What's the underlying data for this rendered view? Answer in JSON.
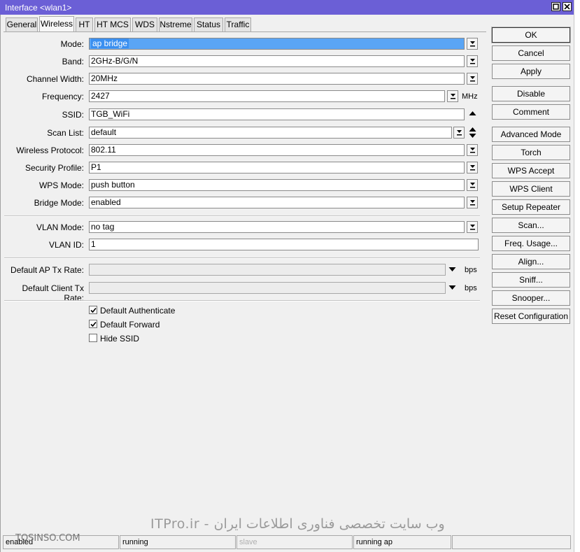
{
  "window": {
    "title": "Interface <wlan1>"
  },
  "tabs": [
    "General",
    "Wireless",
    "HT",
    "HT MCS",
    "WDS",
    "Nstreme",
    "Status",
    "Traffic"
  ],
  "form": {
    "mode": {
      "label": "Mode:",
      "value": "ap bridge"
    },
    "band": {
      "label": "Band:",
      "value": "2GHz-B/G/N"
    },
    "channel_width": {
      "label": "Channel Width:",
      "value": "20MHz"
    },
    "frequency": {
      "label": "Frequency:",
      "value": "2427",
      "unit": "MHz"
    },
    "ssid": {
      "label": "SSID:",
      "value": "TGB_WiFi"
    },
    "scan_list": {
      "label": "Scan List:",
      "value": "default"
    },
    "wireless_protocol": {
      "label": "Wireless Protocol:",
      "value": "802.11"
    },
    "security_profile": {
      "label": "Security Profile:",
      "value": "P1"
    },
    "wps_mode": {
      "label": "WPS Mode:",
      "value": "push button"
    },
    "bridge_mode": {
      "label": "Bridge Mode:",
      "value": "enabled"
    },
    "vlan_mode": {
      "label": "VLAN Mode:",
      "value": "no tag"
    },
    "vlan_id": {
      "label": "VLAN ID:",
      "value": "1"
    },
    "ap_tx_rate": {
      "label": "Default AP Tx Rate:",
      "value": "",
      "unit": "bps"
    },
    "client_tx_rate": {
      "label": "Default Client Tx Rate:",
      "value": "",
      "unit": "bps"
    },
    "checkboxes": [
      {
        "label": "Default Authenticate",
        "checked": true
      },
      {
        "label": "Default Forward",
        "checked": true
      },
      {
        "label": "Hide SSID",
        "checked": false
      }
    ]
  },
  "buttons": [
    "OK",
    "Cancel",
    "Apply",
    "Disable",
    "Comment",
    "Advanced Mode",
    "Torch",
    "WPS Accept",
    "WPS Client",
    "Setup Repeater",
    "Scan...",
    "Freq. Usage...",
    "Align...",
    "Sniff...",
    "Snooper...",
    "Reset Configuration"
  ],
  "status_bar": [
    "enabled",
    "running",
    "slave",
    "running ap",
    ""
  ],
  "watermark": {
    "text": "ITPro.ir - وب سایت تخصصی فناوری اطلاعات ایران",
    "site": "TOSINSO.COM"
  },
  "colors": {
    "titlebar": "#6b5fd6",
    "selection": "#3a8ff0"
  }
}
